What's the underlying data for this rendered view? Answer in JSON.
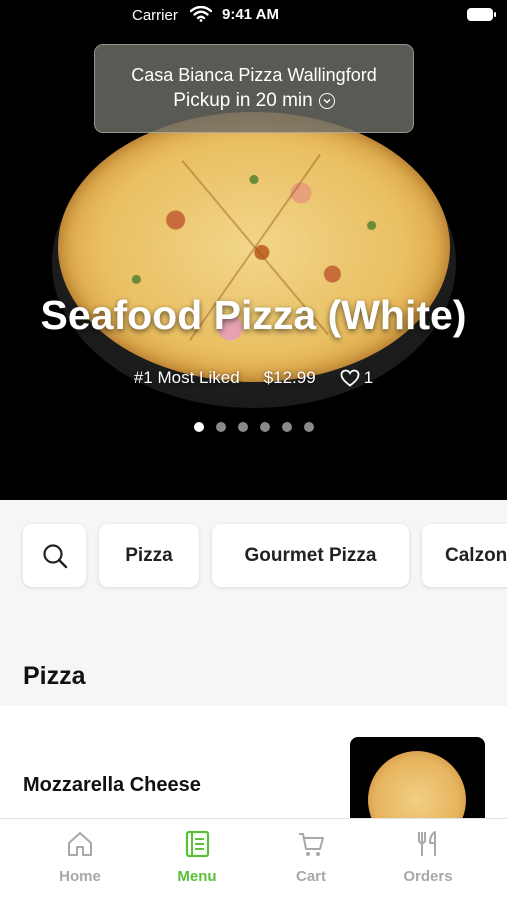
{
  "status_bar": {
    "carrier": "Carrier",
    "time": "9:41 AM"
  },
  "store": {
    "name": "Casa Bianca Pizza Wallingford",
    "pickup": "Pickup in 20 min"
  },
  "featured": {
    "title": "Seafood Pizza (White)",
    "badge": "#1 Most Liked",
    "price": "$12.99",
    "likes": "1",
    "page_count": 6,
    "active_page": 1
  },
  "categories": [
    "Pizza",
    "Gourmet Pizza",
    "Calzon"
  ],
  "section": {
    "title": "Pizza"
  },
  "items": [
    {
      "name": "Mozzarella Cheese"
    }
  ],
  "tabs": [
    {
      "label": "Home",
      "icon": "home-icon"
    },
    {
      "label": "Menu",
      "icon": "menu-book-icon"
    },
    {
      "label": "Cart",
      "icon": "cart-icon"
    },
    {
      "label": "Orders",
      "icon": "fork-knife-icon"
    }
  ],
  "colors": {
    "accent": "#5bbf3a",
    "inactive": "#a8a8a8",
    "hero_bg": "#000000"
  }
}
